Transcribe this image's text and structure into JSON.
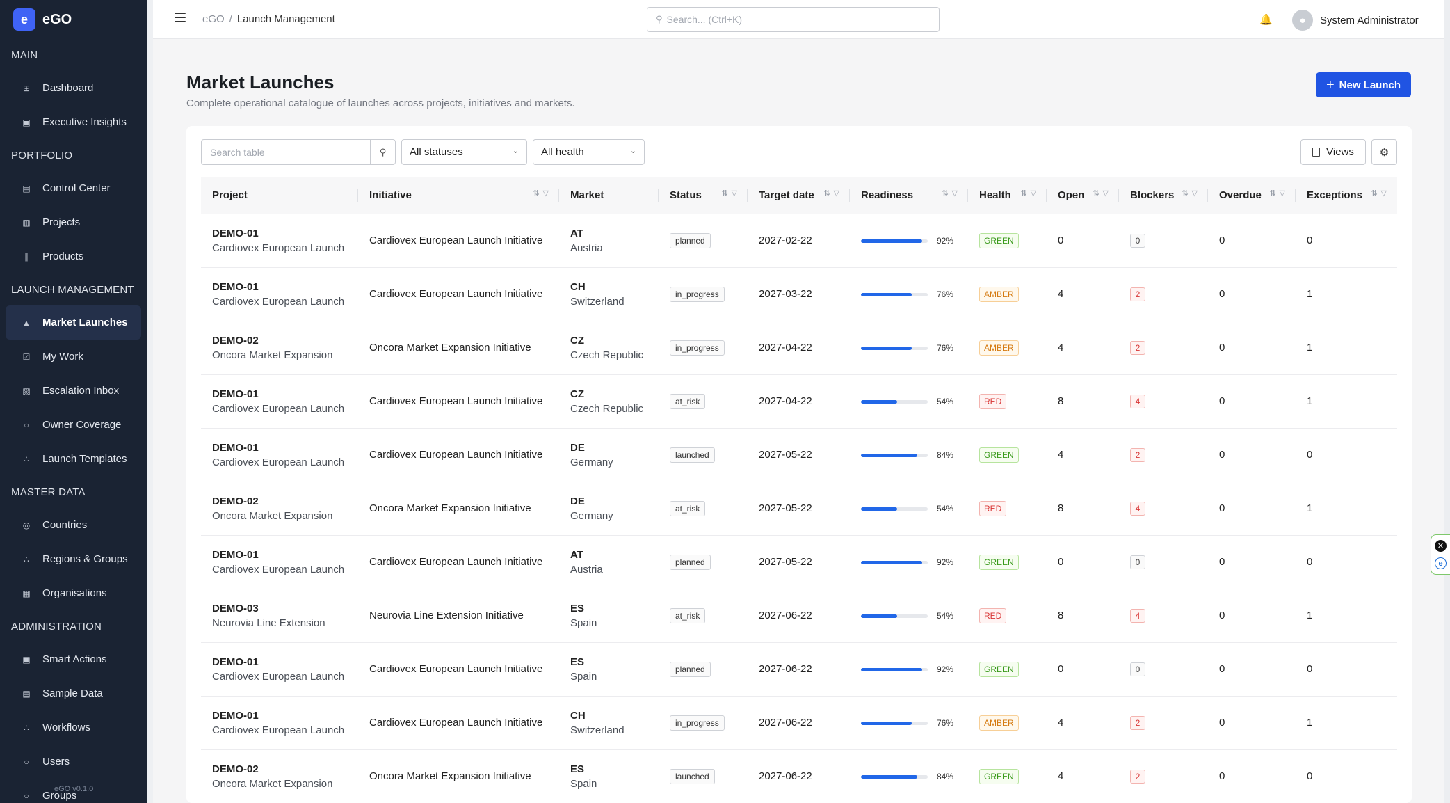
{
  "app": {
    "logo_letter": "e",
    "name": "eGO",
    "version": "eGO v0.1.0"
  },
  "sidebar": {
    "sections": [
      {
        "label": "MAIN",
        "items": [
          {
            "label": "Dashboard",
            "icon": "grid-icon"
          },
          {
            "label": "Executive Insights",
            "icon": "presentation-icon"
          }
        ]
      },
      {
        "label": "PORTFOLIO",
        "items": [
          {
            "label": "Control Center",
            "icon": "calendar-icon"
          },
          {
            "label": "Projects",
            "icon": "clipboard-icon"
          },
          {
            "label": "Products",
            "icon": "barcode-icon"
          }
        ]
      },
      {
        "label": "LAUNCH MANAGEMENT",
        "items": [
          {
            "label": "Market Launches",
            "icon": "rocket-icon",
            "active": true
          },
          {
            "label": "My Work",
            "icon": "check-square-icon"
          },
          {
            "label": "Escalation Inbox",
            "icon": "inbox-icon"
          },
          {
            "label": "Owner Coverage",
            "icon": "user-icon"
          },
          {
            "label": "Launch Templates",
            "icon": "workflow-icon"
          }
        ]
      },
      {
        "label": "MASTER DATA",
        "items": [
          {
            "label": "Countries",
            "icon": "globe-icon"
          },
          {
            "label": "Regions & Groups",
            "icon": "workflow-icon"
          },
          {
            "label": "Organisations",
            "icon": "building-icon"
          }
        ]
      },
      {
        "label": "ADMINISTRATION",
        "items": [
          {
            "label": "Smart Actions",
            "icon": "bot-icon"
          },
          {
            "label": "Sample Data",
            "icon": "database-icon"
          },
          {
            "label": "Workflows",
            "icon": "workflow-icon"
          },
          {
            "label": "Users",
            "icon": "user-icon"
          },
          {
            "label": "Groups",
            "icon": "users-icon"
          }
        ]
      }
    ]
  },
  "header": {
    "breadcrumb": [
      "eGO",
      "Launch Management"
    ],
    "search_placeholder": "Search... (Ctrl+K)",
    "user_name": "System Administrator"
  },
  "page": {
    "title": "Market Launches",
    "subtitle": "Complete operational catalogue of launches across projects, initiatives and markets.",
    "new_button": "New Launch"
  },
  "toolbar": {
    "search_placeholder": "Search table",
    "status_filter": "All statuses",
    "health_filter": "All health",
    "views_label": "Views"
  },
  "table": {
    "columns": [
      "Project",
      "Initiative",
      "Market",
      "Status",
      "Target date",
      "Readiness",
      "Health",
      "Open",
      "Blockers",
      "Overdue",
      "Exceptions"
    ],
    "rows": [
      {
        "code": "DEMO-01",
        "project": "Cardiovex European Launch",
        "initiative": "Cardiovex European Launch Initiative",
        "market_code": "AT",
        "market": "Austria",
        "status": "planned",
        "target": "2027-02-22",
        "readiness": 92,
        "readiness_label": "92%",
        "health": "GREEN",
        "open": "0",
        "blockers": "0",
        "overdue": "0",
        "exceptions": "0"
      },
      {
        "code": "DEMO-01",
        "project": "Cardiovex European Launch",
        "initiative": "Cardiovex European Launch Initiative",
        "market_code": "CH",
        "market": "Switzerland",
        "status": "in_progress",
        "target": "2027-03-22",
        "readiness": 76,
        "readiness_label": "76%",
        "health": "AMBER",
        "open": "4",
        "blockers": "2",
        "overdue": "0",
        "exceptions": "1"
      },
      {
        "code": "DEMO-02",
        "project": "Oncora Market Expansion",
        "initiative": "Oncora Market Expansion Initiative",
        "market_code": "CZ",
        "market": "Czech Republic",
        "status": "in_progress",
        "target": "2027-04-22",
        "readiness": 76,
        "readiness_label": "76%",
        "health": "AMBER",
        "open": "4",
        "blockers": "2",
        "overdue": "0",
        "exceptions": "1"
      },
      {
        "code": "DEMO-01",
        "project": "Cardiovex European Launch",
        "initiative": "Cardiovex European Launch Initiative",
        "market_code": "CZ",
        "market": "Czech Republic",
        "status": "at_risk",
        "target": "2027-04-22",
        "readiness": 54,
        "readiness_label": "54%",
        "health": "RED",
        "open": "8",
        "blockers": "4",
        "overdue": "0",
        "exceptions": "1"
      },
      {
        "code": "DEMO-01",
        "project": "Cardiovex European Launch",
        "initiative": "Cardiovex European Launch Initiative",
        "market_code": "DE",
        "market": "Germany",
        "status": "launched",
        "target": "2027-05-22",
        "readiness": 84,
        "readiness_label": "84%",
        "health": "GREEN",
        "open": "4",
        "blockers": "2",
        "overdue": "0",
        "exceptions": "0"
      },
      {
        "code": "DEMO-02",
        "project": "Oncora Market Expansion",
        "initiative": "Oncora Market Expansion Initiative",
        "market_code": "DE",
        "market": "Germany",
        "status": "at_risk",
        "target": "2027-05-22",
        "readiness": 54,
        "readiness_label": "54%",
        "health": "RED",
        "open": "8",
        "blockers": "4",
        "overdue": "0",
        "exceptions": "1"
      },
      {
        "code": "DEMO-01",
        "project": "Cardiovex European Launch",
        "initiative": "Cardiovex European Launch Initiative",
        "market_code": "AT",
        "market": "Austria",
        "status": "planned",
        "target": "2027-05-22",
        "readiness": 92,
        "readiness_label": "92%",
        "health": "GREEN",
        "open": "0",
        "blockers": "0",
        "overdue": "0",
        "exceptions": "0"
      },
      {
        "code": "DEMO-03",
        "project": "Neurovia Line Extension",
        "initiative": "Neurovia Line Extension Initiative",
        "market_code": "ES",
        "market": "Spain",
        "status": "at_risk",
        "target": "2027-06-22",
        "readiness": 54,
        "readiness_label": "54%",
        "health": "RED",
        "open": "8",
        "blockers": "4",
        "overdue": "0",
        "exceptions": "1"
      },
      {
        "code": "DEMO-01",
        "project": "Cardiovex European Launch",
        "initiative": "Cardiovex European Launch Initiative",
        "market_code": "ES",
        "market": "Spain",
        "status": "planned",
        "target": "2027-06-22",
        "readiness": 92,
        "readiness_label": "92%",
        "health": "GREEN",
        "open": "0",
        "blockers": "0",
        "overdue": "0",
        "exceptions": "0"
      },
      {
        "code": "DEMO-01",
        "project": "Cardiovex European Launch",
        "initiative": "Cardiovex European Launch Initiative",
        "market_code": "CH",
        "market": "Switzerland",
        "status": "in_progress",
        "target": "2027-06-22",
        "readiness": 76,
        "readiness_label": "76%",
        "health": "AMBER",
        "open": "4",
        "blockers": "2",
        "overdue": "0",
        "exceptions": "1"
      },
      {
        "code": "DEMO-02",
        "project": "Oncora Market Expansion",
        "initiative": "Oncora Market Expansion Initiative",
        "market_code": "ES",
        "market": "Spain",
        "status": "launched",
        "target": "2027-06-22",
        "readiness": 84,
        "readiness_label": "84%",
        "health": "GREEN",
        "open": "4",
        "blockers": "2",
        "overdue": "0",
        "exceptions": "0"
      }
    ]
  },
  "widget": {
    "close_glyph": "✕",
    "logo_glyph": "e"
  }
}
